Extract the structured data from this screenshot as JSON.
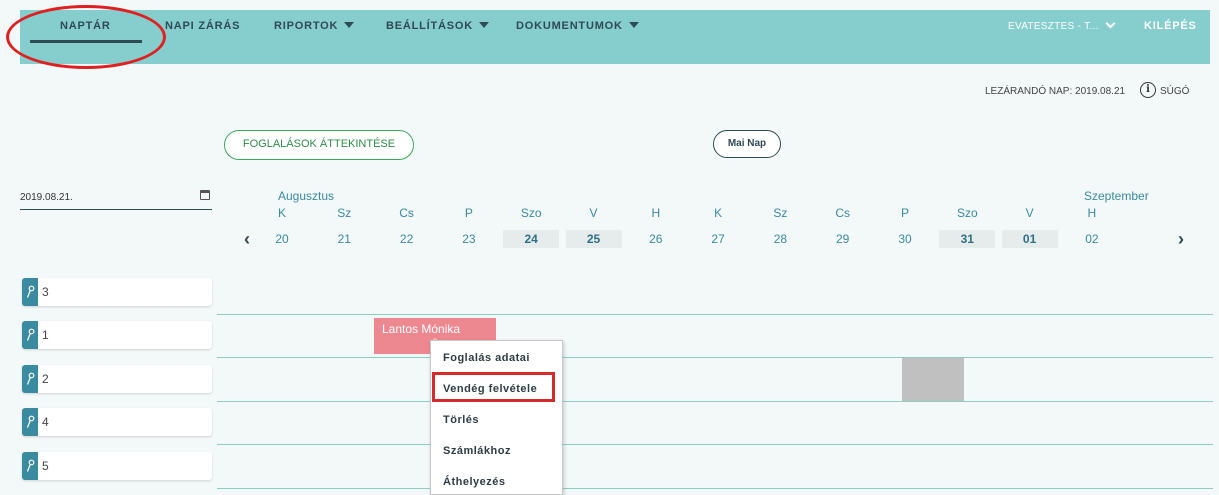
{
  "nav": {
    "items": [
      {
        "label": "NAPTÁR"
      },
      {
        "label": "NAPI ZÁRÁS"
      },
      {
        "label": "RIPORTOK"
      },
      {
        "label": "BEÁLLÍTÁSOK"
      },
      {
        "label": "DOKUMENTUMOK"
      }
    ],
    "user": "EVATESZTES - T...",
    "logout": "KILÉPÉS"
  },
  "status": {
    "closing_day": "LEZÁRANDÓ NAP: 2019.08.21",
    "help_icon": "i",
    "help_label": "SÚGÓ"
  },
  "buttons": {
    "overview": "FOGLALÁSOK ÁTTEKINTÉSE",
    "today": "Mai Nap"
  },
  "date_field": {
    "value": "2019.08.21."
  },
  "calendar": {
    "months": [
      "Augusztus",
      "Szeptember"
    ],
    "days": [
      {
        "dow": "K",
        "num": "20",
        "weekend": false
      },
      {
        "dow": "Sz",
        "num": "21",
        "weekend": false
      },
      {
        "dow": "Cs",
        "num": "22",
        "weekend": false
      },
      {
        "dow": "P",
        "num": "23",
        "weekend": false
      },
      {
        "dow": "Szo",
        "num": "24",
        "weekend": true
      },
      {
        "dow": "V",
        "num": "25",
        "weekend": true
      },
      {
        "dow": "H",
        "num": "26",
        "weekend": false
      },
      {
        "dow": "K",
        "num": "27",
        "weekend": false
      },
      {
        "dow": "Sz",
        "num": "28",
        "weekend": false
      },
      {
        "dow": "Cs",
        "num": "29",
        "weekend": false
      },
      {
        "dow": "P",
        "num": "30",
        "weekend": false
      },
      {
        "dow": "Szo",
        "num": "31",
        "weekend": true
      },
      {
        "dow": "V",
        "num": "01",
        "weekend": true
      },
      {
        "dow": "H",
        "num": "02",
        "weekend": false
      }
    ],
    "prev": "‹",
    "next": "›"
  },
  "rooms": [
    {
      "num": "3"
    },
    {
      "num": "1"
    },
    {
      "num": "2"
    },
    {
      "num": "4"
    },
    {
      "num": "5"
    }
  ],
  "booking": {
    "guest": "Lantos Mónika",
    "sub": "0"
  },
  "context_menu": {
    "items": [
      {
        "label": "Foglalás adatai"
      },
      {
        "label": "Vendég felvétele"
      },
      {
        "label": "Törlés"
      },
      {
        "label": "Számlákhoz"
      },
      {
        "label": "Áthelyezés"
      }
    ]
  },
  "colors": {
    "header_bg": "#86cdcd",
    "accent": "#3a8aa0",
    "booking": "#ee8890",
    "annotation": "#e02020"
  }
}
